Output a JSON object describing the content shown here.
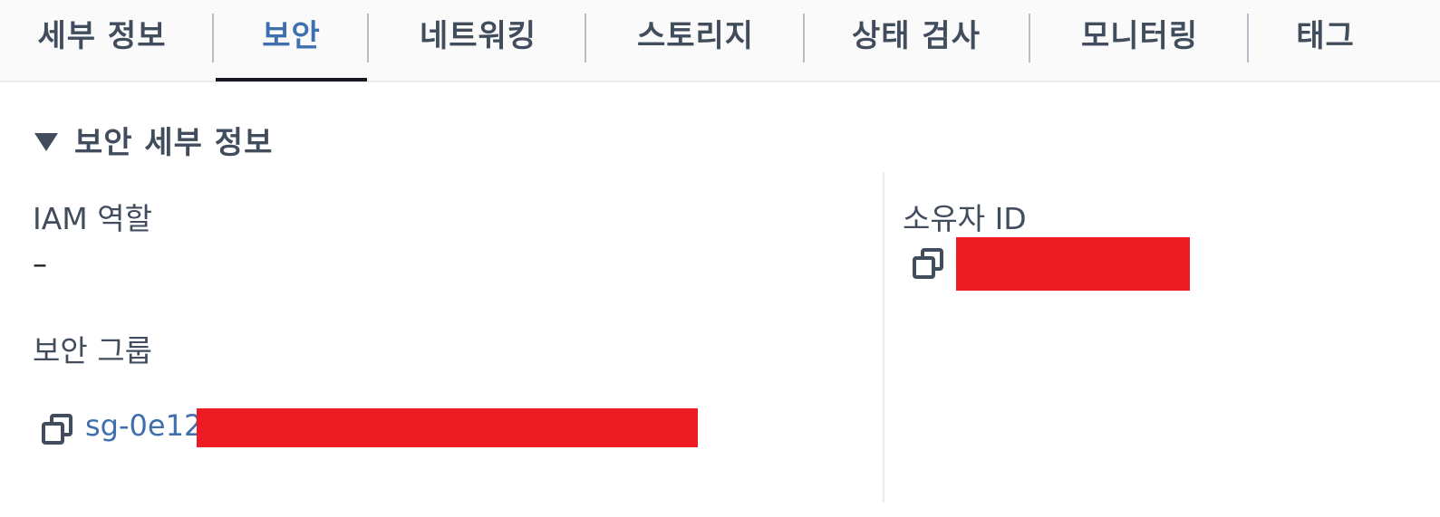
{
  "tabs": [
    {
      "label": "세부 정보",
      "active": false
    },
    {
      "label": "보안",
      "active": true
    },
    {
      "label": "네트워킹",
      "active": false
    },
    {
      "label": "스토리지",
      "active": false
    },
    {
      "label": "상태 검사",
      "active": false
    },
    {
      "label": "모니터링",
      "active": false
    },
    {
      "label": "태그",
      "active": false
    }
  ],
  "section": {
    "title": "보안 세부 정보",
    "expanded": true
  },
  "fields": {
    "iam_role": {
      "label": "IAM 역할",
      "value": "–"
    },
    "security_group": {
      "label": "보안 그룹",
      "value_prefix": "sg-0e12"
    },
    "owner_id": {
      "label": "소유자 ID"
    }
  },
  "colors": {
    "accent_link": "#3f6fae",
    "redaction": "#ed1c24",
    "text_secondary": "#414d5c"
  },
  "icons": {
    "caret": "caret-down-icon",
    "copy": "copy-icon"
  }
}
